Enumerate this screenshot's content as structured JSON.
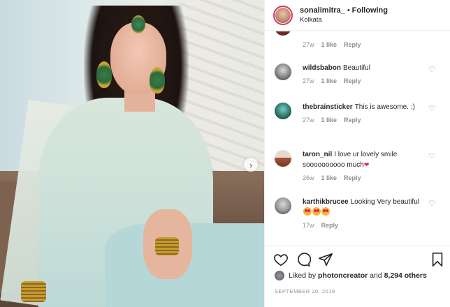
{
  "post": {
    "username": "sonalimitra_",
    "separator": "•",
    "follow_state": "Following",
    "location": "Kolkata"
  },
  "comments": [
    {
      "username": "",
      "text": "",
      "age": "27w",
      "likes": "1 like",
      "reply": "Reply"
    },
    {
      "username": "wildsbabon",
      "text": "Beautiful",
      "age": "27w",
      "likes": "1 like",
      "reply": "Reply"
    },
    {
      "username": "thebrainsticker",
      "text": "This is awesome. :)",
      "age": "27w",
      "likes": "1 like",
      "reply": "Reply"
    },
    {
      "username": "taron_nil",
      "text": "I love ur lovely smile soooooooooo much",
      "age": "26w",
      "likes": "1 like",
      "reply": "Reply",
      "emoji": "❤"
    },
    {
      "username": "karthikbrucee",
      "text": "Looking Very beautiful",
      "age": "17w",
      "reply": "Reply",
      "emoji": "😍😍😍"
    }
  ],
  "likes": {
    "prefix": "Liked by",
    "user": "photoncreator",
    "middle": "and",
    "count": "8,294 others"
  },
  "date": "SEPTEMBER 20, 2019",
  "colors": {
    "avatar_ring": "#e1306c",
    "meta_text": "#8e8e8e",
    "text": "#262626"
  },
  "icons": {
    "next": "chevron-right-icon",
    "like": "heart-icon",
    "comment": "comment-icon",
    "share": "send-icon",
    "save": "bookmark-icon"
  }
}
